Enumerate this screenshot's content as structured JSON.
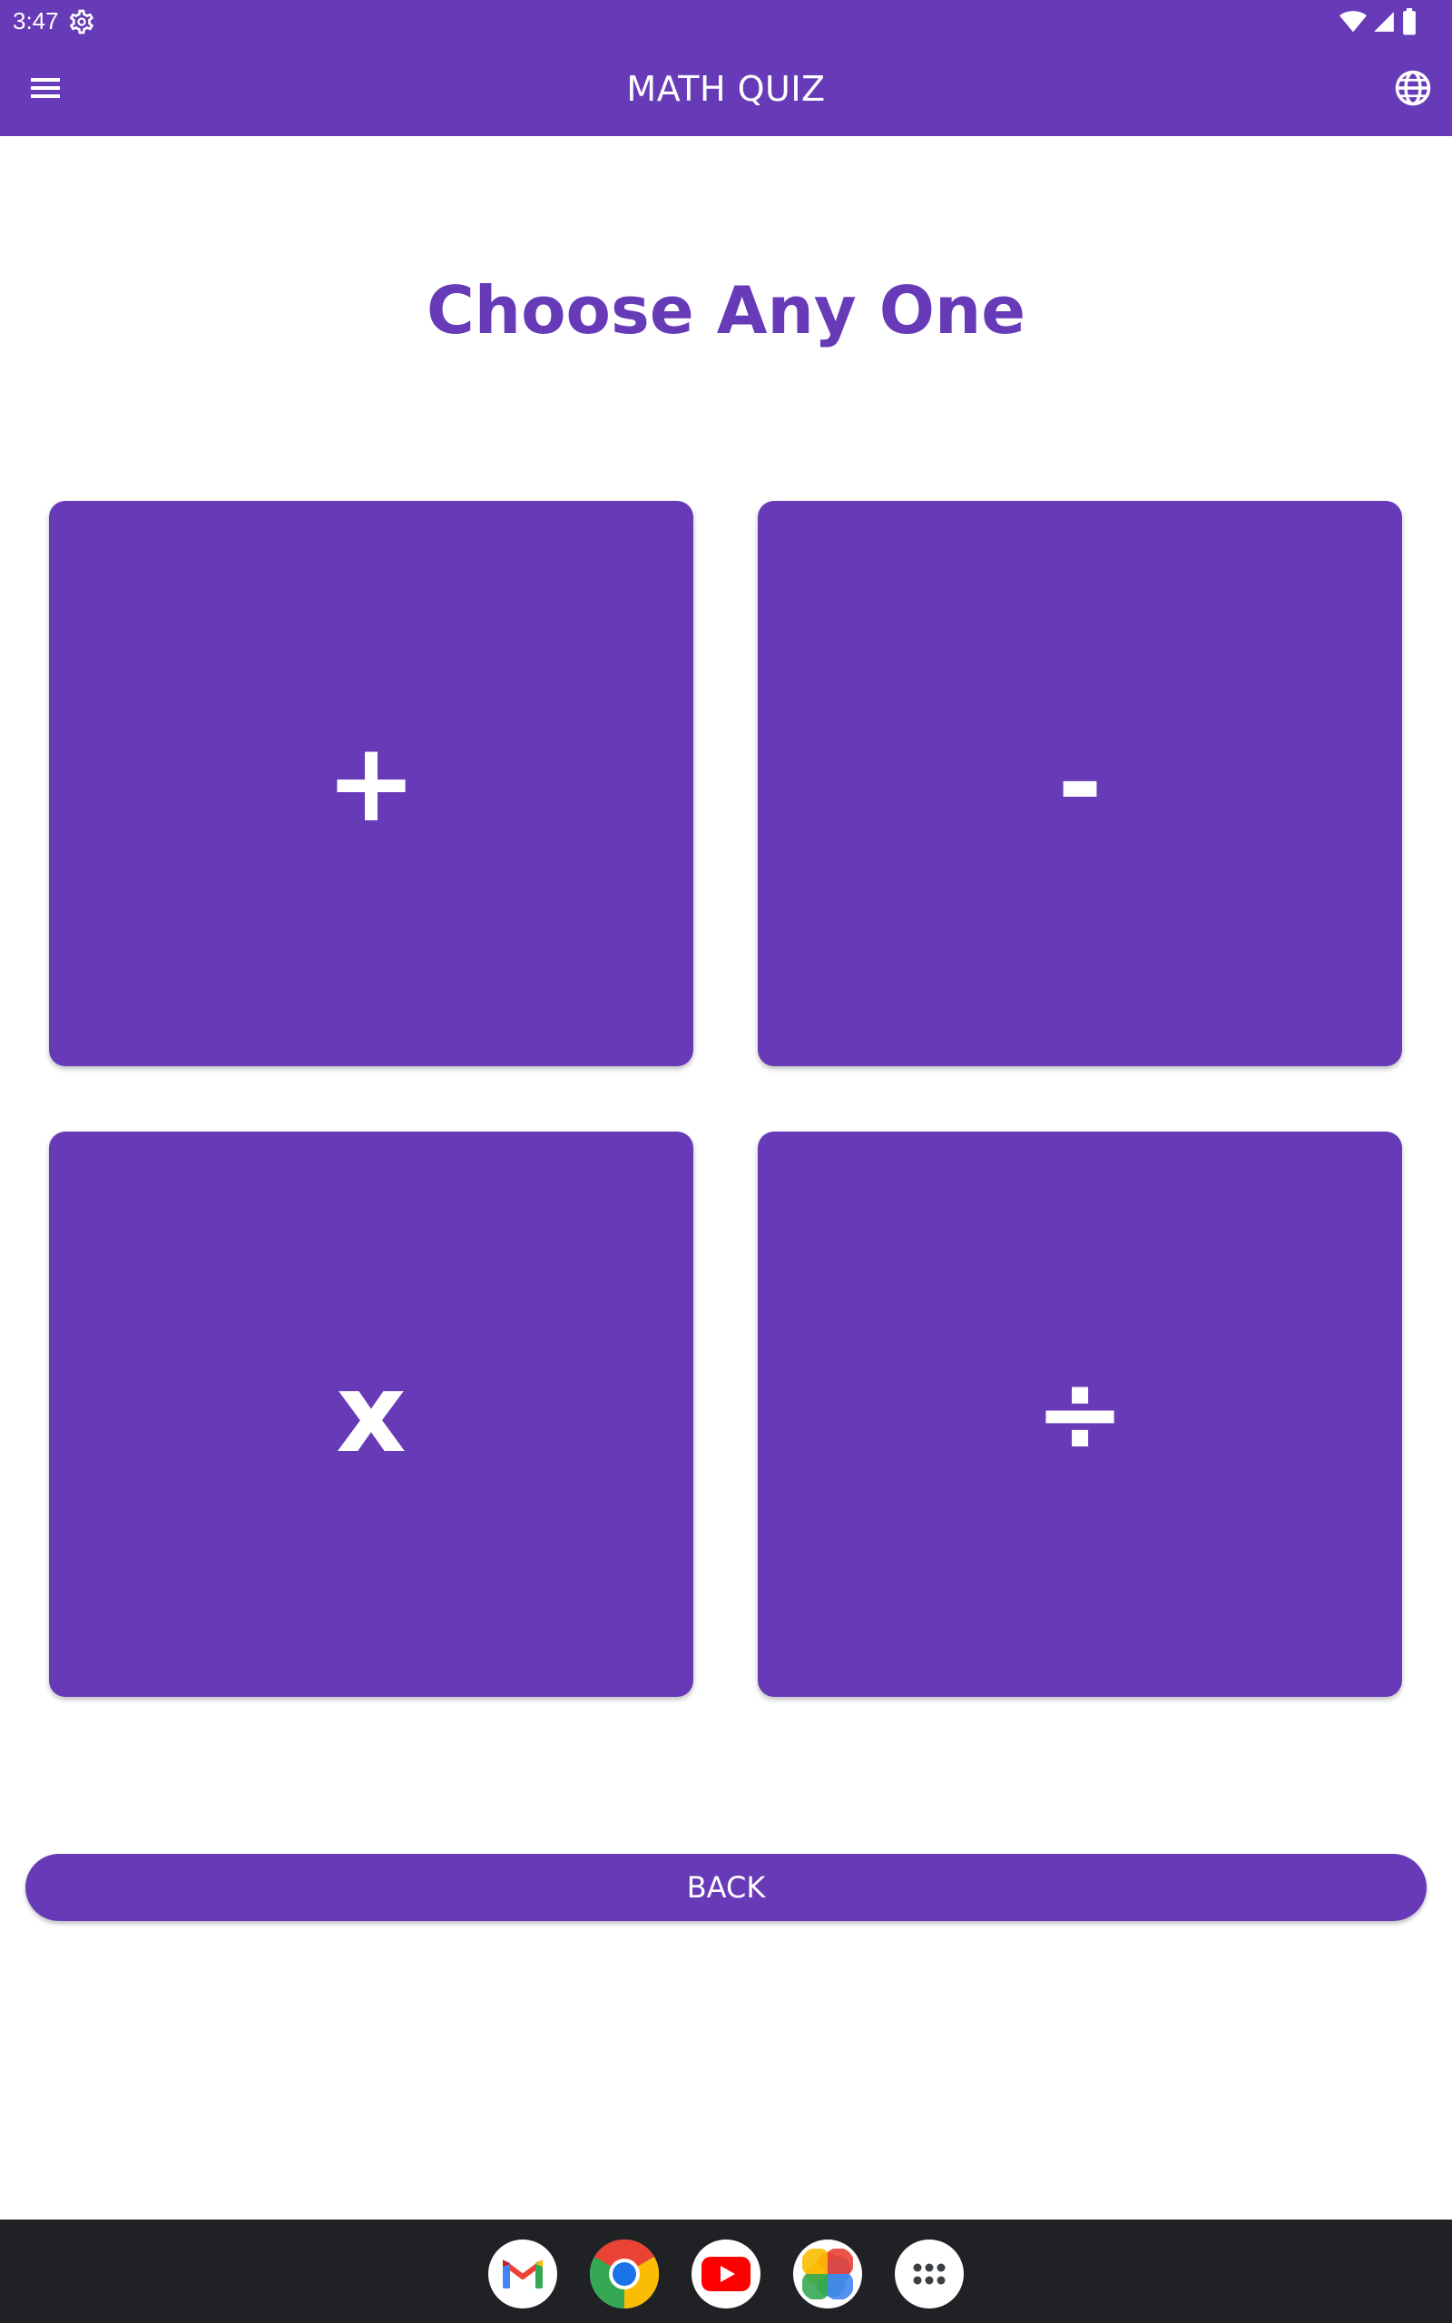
{
  "status_bar": {
    "time": "3:47",
    "icons": [
      "settings-gear-icon",
      "wifi-icon",
      "signal-icon",
      "battery-icon"
    ]
  },
  "app_bar": {
    "title": "MATH QUIZ",
    "left_icon": "menu-icon",
    "right_icon": "globe-icon",
    "color": "#673ab7"
  },
  "main": {
    "heading": "Choose Any One",
    "operations": [
      {
        "id": "add",
        "symbol": "+"
      },
      {
        "id": "subtract",
        "symbol": "-"
      },
      {
        "id": "multiply",
        "symbol": "x"
      },
      {
        "id": "divide",
        "symbol": "÷"
      }
    ],
    "back_label": "BACK"
  },
  "dock": {
    "apps": [
      "gmail-icon",
      "chrome-icon",
      "youtube-icon",
      "photos-icon",
      "app-drawer-icon"
    ]
  },
  "colors": {
    "accent": "#673ab7",
    "text_on_accent": "#ffffff",
    "taskbar": "#202124"
  }
}
